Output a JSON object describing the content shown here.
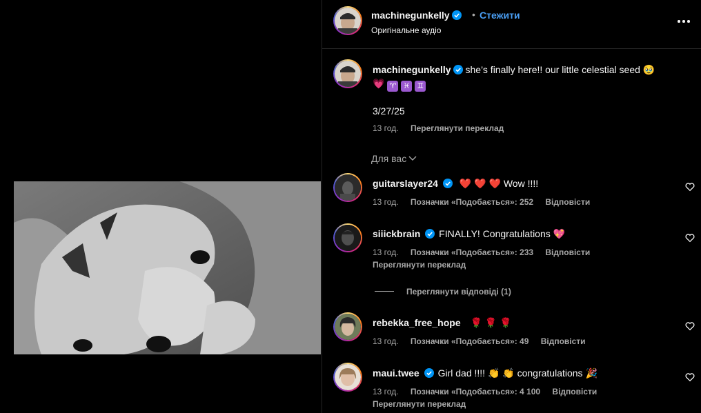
{
  "post": {
    "username": "machinegunkelly",
    "follow_label": "Стежити",
    "audio_label": "Оригінальне аудіо",
    "dot": "•"
  },
  "caption": {
    "username": "machinegunkelly",
    "text": "she’s finally here!! our little celestial seed",
    "date": "3/27/25",
    "time": "13 год.",
    "translate": "Переглянути переклад"
  },
  "sort_label": "Для вас",
  "comments": [
    {
      "username": "guitarslayer24",
      "verified": true,
      "text": "Wow !!!!",
      "time": "13 год.",
      "likes": "Позначки «Подобається»: 252",
      "reply": "Відповісти"
    },
    {
      "username": "siiickbrain",
      "verified": true,
      "text": "FINALLY! Congratulations",
      "time": "13 год.",
      "likes": "Позначки «Подобається»: 233",
      "reply": "Відповісти",
      "translate": "Переглянути переклад"
    },
    {
      "username": "rebekka_free_hope",
      "verified": false,
      "text": "",
      "time": "13 год.",
      "likes": "Позначки «Подобається»: 49",
      "reply": "Відповісти"
    },
    {
      "username": "maui.twee",
      "verified": true,
      "text": "Girl dad !!!!",
      "text2": "congratulations",
      "time": "13 год.",
      "likes": "Позначки «Подобається»: 4 100",
      "reply": "Відповісти",
      "translate": "Переглянути переклад"
    }
  ],
  "view_replies": "Переглянути відповіді (1)",
  "icons": [
    "verified-badge-icon",
    "more-options-icon",
    "heart-icon",
    "chevron-down-icon"
  ],
  "colors": {
    "background": "#000000",
    "link": "#4a9ff5",
    "secondary_text": "#a8a8a8",
    "verified": "#0095f6"
  }
}
